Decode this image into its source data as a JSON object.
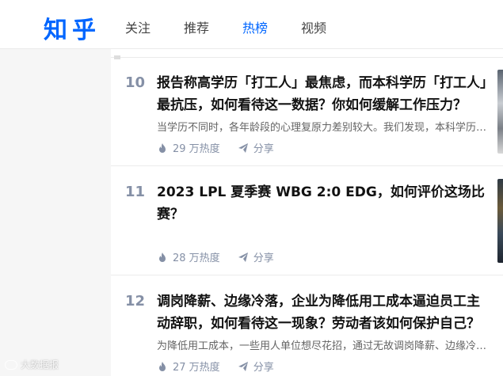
{
  "header": {
    "logo": "知乎",
    "tabs": [
      {
        "label": "关注"
      },
      {
        "label": "推荐"
      },
      {
        "label": "热榜",
        "active": true
      },
      {
        "label": "视频"
      }
    ]
  },
  "items": [
    {
      "rank": "10",
      "title": "报告称高学历「打工人」最焦虑，而本科学历「打工人」最抗压，如何看待这一数据？你如何缓解工作压力？",
      "excerpt": "当学历不同时，各年龄段的心理复原力差别较大。我们发现，本科学历的打工人心理复原力最强……",
      "heat": "29 万热度",
      "share": "分享"
    },
    {
      "rank": "11",
      "title": "2023 LPL 夏季赛 WBG 2:0 EDG，如何评价这场比赛？",
      "excerpt": "",
      "heat": "28 万热度",
      "share": "分享"
    },
    {
      "rank": "12",
      "title": "调岗降薪、边缘冷落，企业为降低用工成本逼迫员工主动辞职，如何看待这一现象？劳动者该如何保护自己？",
      "excerpt": "为降低用工成本，一些用人单位想尽花招，通过无故调岗降薪、边缘冷落等方式逼迫员工……",
      "heat": "27 万热度",
      "share": "分享"
    }
  ],
  "watermark": "大数据报",
  "colors": {
    "brand": "#0066ff",
    "meta": "#8590a6"
  }
}
